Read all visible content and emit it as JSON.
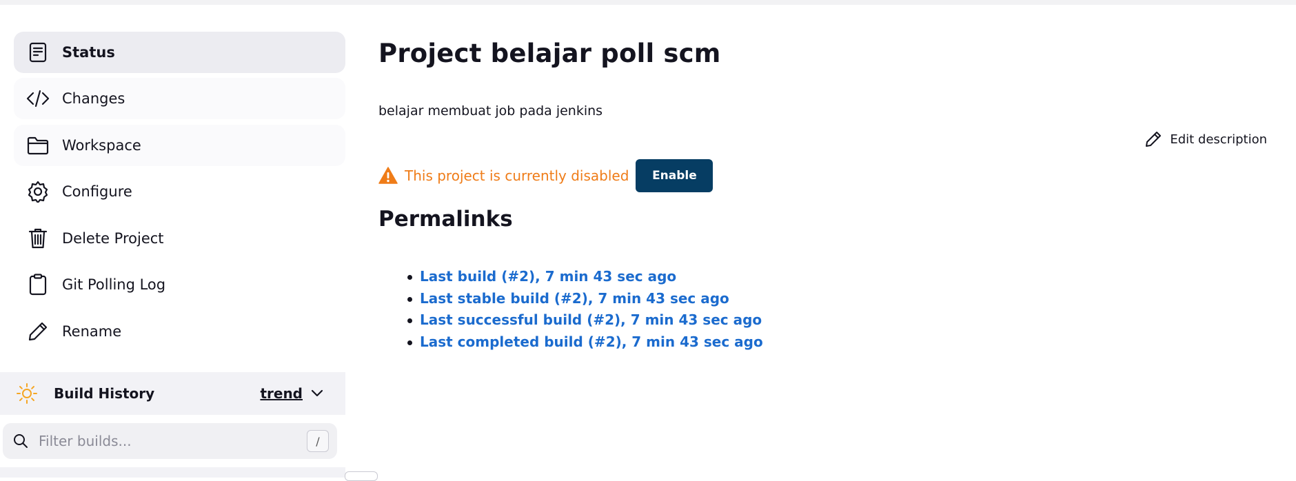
{
  "sidebar": {
    "tasks": [
      {
        "label": "Status",
        "icon": "document-icon"
      },
      {
        "label": "Changes",
        "icon": "code-icon"
      },
      {
        "label": "Workspace",
        "icon": "folder-icon"
      },
      {
        "label": "Configure",
        "icon": "gear-icon"
      },
      {
        "label": "Delete Project",
        "icon": "trash-icon"
      },
      {
        "label": "Git Polling Log",
        "icon": "clipboard-icon"
      },
      {
        "label": "Rename",
        "icon": "pencil-icon"
      }
    ],
    "build_history": {
      "title": "Build History",
      "trend_label": "trend",
      "icon": "sun-icon"
    },
    "filter": {
      "placeholder": "Filter builds...",
      "shortcut": "/"
    }
  },
  "main": {
    "title": "Project belajar poll scm",
    "description": "belajar membuat job pada jenkins",
    "edit_description_label": "Edit description",
    "disabled_notice": "This project is currently disabled",
    "enable_button": "Enable",
    "permalinks_title": "Permalinks",
    "permalinks": [
      "Last build (#2), 7 min 43 sec ago",
      "Last stable build (#2), 7 min 43 sec ago",
      "Last successful build (#2), 7 min 43 sec ago",
      "Last completed build (#2), 7 min 43 sec ago"
    ]
  },
  "colors": {
    "warning": "#ef7c18",
    "link": "#1b6bce",
    "enable_button_bg": "#063d63",
    "sun_icon": "#f5a623"
  }
}
